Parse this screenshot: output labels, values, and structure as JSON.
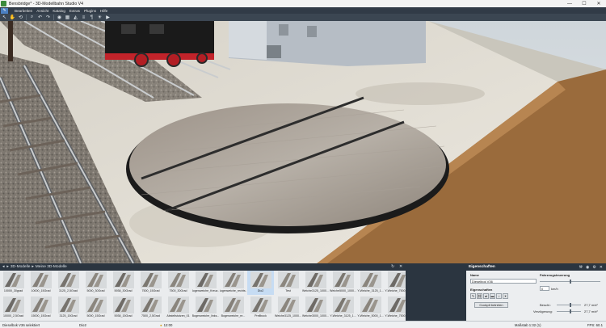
{
  "window": {
    "title": "Bensbridge* - 3D-Modellbahn Studio V4",
    "controls": [
      "—",
      "☐",
      "✕"
    ]
  },
  "menu": {
    "items": [
      "Bearbeiten",
      "Ansicht",
      "Katalog",
      "Extras",
      "Plugins",
      "Hilfe"
    ]
  },
  "toolbar": {
    "icons": [
      "cursor-icon",
      "hand-icon",
      "rotate-icon",
      "zoom-icon",
      "undo-icon",
      "redo-icon",
      "camera-icon",
      "grid-icon",
      "terrain-icon",
      "track-icon",
      "signal-icon",
      "light-icon",
      "play-icon"
    ]
  },
  "library": {
    "breadcrumb_root": "3D-Modelle",
    "breadcrumb_sub": "Meine 3D-Modelle",
    "items_row1": [
      "10000_30grad",
      "10000_15Grad",
      "3125_2,5Grad",
      "5000_30Grad",
      "5938_30Grad",
      "7500_15Grad",
      "7500_30Grad",
      "Bogenweiche_Kreuz...",
      "Bogenweiche_rechts...",
      "Dio2",
      "Test",
      "Weiche3125_1000...",
      "Weiche5000_1000...",
      "Y-Weiche_3125_1...",
      "Y-Weiche_7500_1..."
    ],
    "items_row2": [
      "10000_2,5Grad",
      "15000_15Grad",
      "3125_15Grad",
      "5000_15Grad",
      "5938_15Grad",
      "7500_2,5Grad",
      "Abstellstutzen_01",
      "Bogenweiche_links...",
      "Bogenweiche_re...",
      "Prellbock",
      "Weiche3125_1000...",
      "Weiche3000_1000...",
      "Y-Weiche_3125_1...",
      "Y-Weiche_5000_1...",
      "Y-Weiche_7500_1..."
    ],
    "selected_index": 9
  },
  "properties": {
    "tab": "Eigenschaften",
    "name_label": "Name",
    "name_value": "Dieselbok V36",
    "fahrzeug_label": "Fahrzeugsteuerung",
    "speed_value": "0",
    "speed_unit": "km/h",
    "eigenschaften_label": "Eigenschaften",
    "cockpit_button": "Cockpit betreten",
    "beschl_label": "Beschl.:",
    "beschl_value": "27,7 m/s²",
    "verz_label": "Verzögerung:",
    "verz_value": "27,7 m/s²"
  },
  "status": {
    "object": "Dieselbok V36 selektiert",
    "name": "Dio2",
    "time": "12:00",
    "scale": "Maßstab 1:32 (1)",
    "fps": "FPS: 60.1"
  },
  "colors": {
    "accent": "#4a7fc0",
    "dark_panel": "#2b3540",
    "selection": "#c6dcf3"
  }
}
